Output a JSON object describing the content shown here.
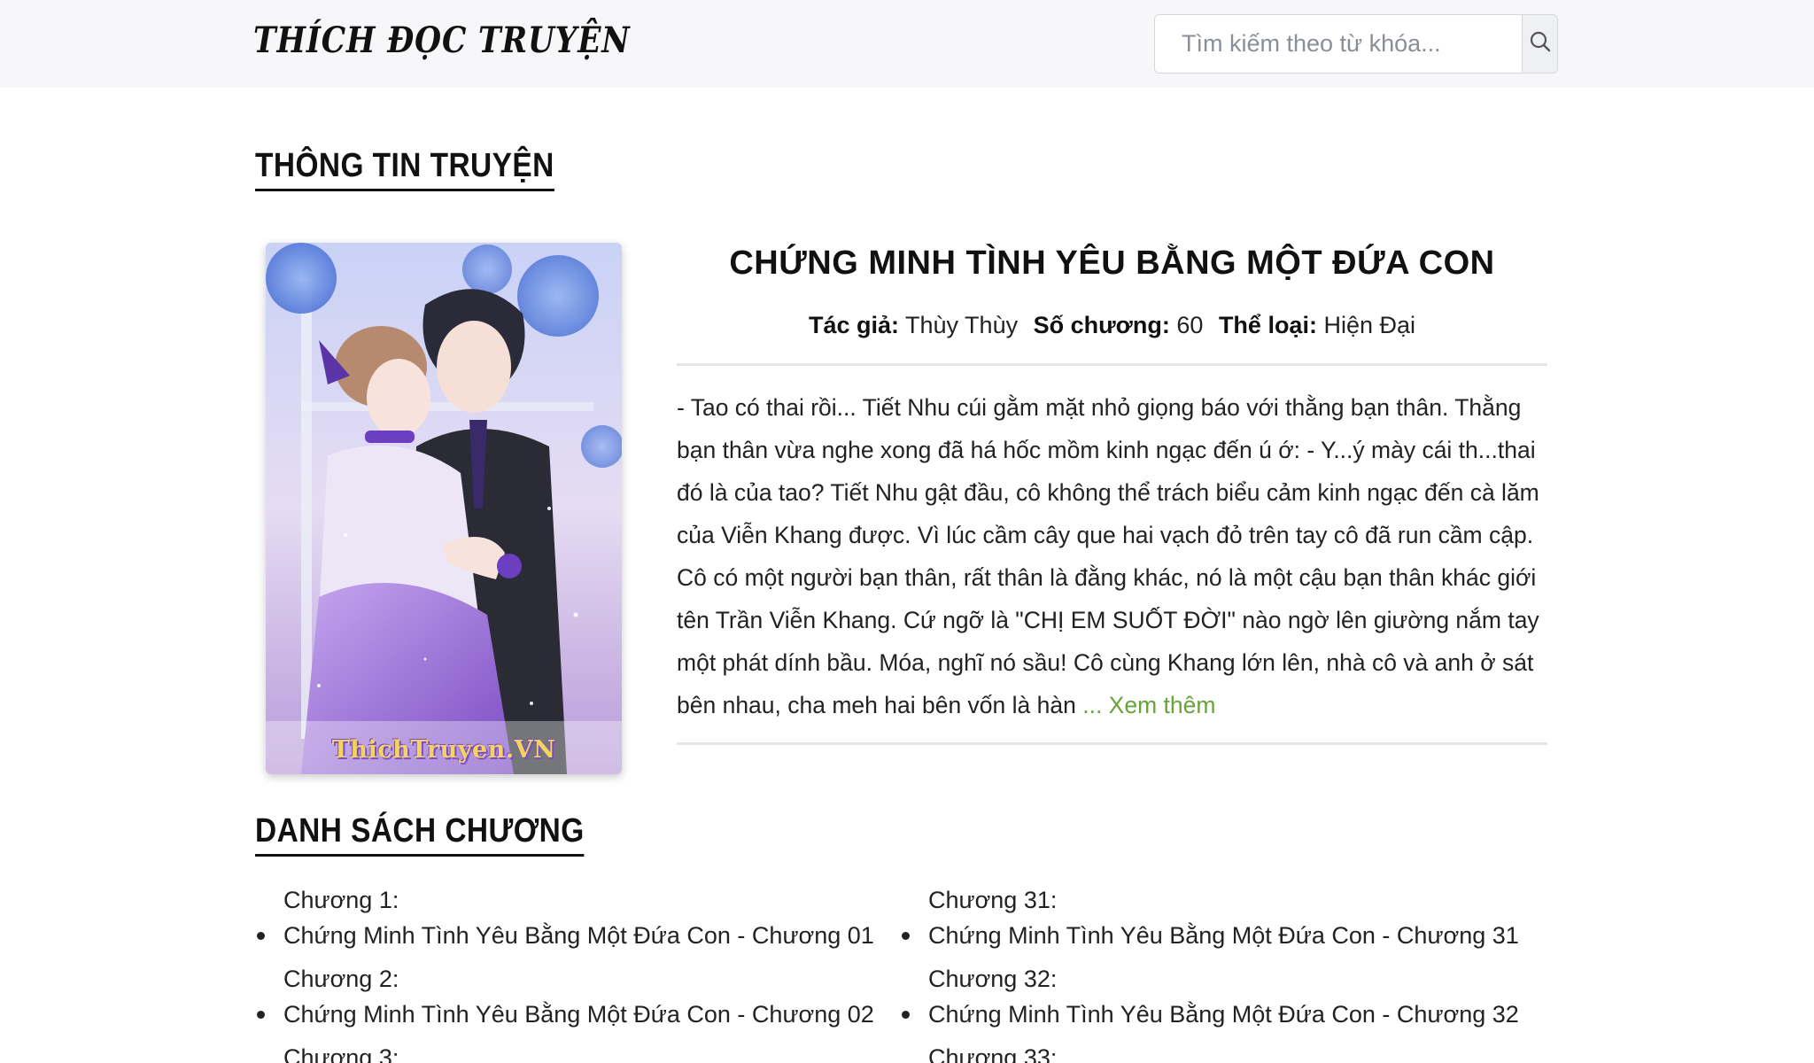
{
  "header": {
    "logo_text": "THÍCH ĐỌC TRUYỆN",
    "search_placeholder": "Tìm kiếm theo từ khóa...",
    "search_icon": "search-icon"
  },
  "info_section": {
    "heading": "THÔNG TIN TRUYỆN"
  },
  "cover": {
    "watermark": "ThichTruyen.VN"
  },
  "story": {
    "title": "CHỨNG MINH TÌNH YÊU BẰNG MỘT ĐỨA CON",
    "author_label": "Tác giả:",
    "author": "Thùy Thùy",
    "chapters_label": "Số chương:",
    "chapters_count": "60",
    "genre_label": "Thể loại:",
    "genre": "Hiện Đại",
    "description": "- Tao có thai rồi... Tiết Nhu cúi gằm mặt nhỏ giọng báo với thằng bạn thân. Thằng bạn thân vừa nghe xong đã há hốc mồm kinh ngạc đến ú ớ: - Y...ý mày cái th...thai đó là của tao? Tiết Nhu gật đầu, cô không thể trách biểu cảm kinh ngạc đến cà lăm của Viễn Khang được. Vì lúc cầm cây que hai vạch đỏ trên tay cô đã run cầm cập. Cô có một người bạn thân, rất thân là đằng khác, nó là một cậu bạn thân khác giới tên Trần Viễn Khang. Cứ ngỡ là \"CHỊ EM SUỐT ĐỜI\" nào ngờ lên giường nắm tay một phát dính bầu. Móa, nghĩ nó sầu! Cô cùng Khang lớn lên, nhà cô và anh ở sát bên nhau, cha meh hai bên vốn là hàn",
    "read_more": "... Xem thêm"
  },
  "chapter_section": {
    "heading": "DANH SÁCH CHƯƠNG"
  },
  "chapter_columns": [
    [
      {
        "label": "Chương 1:",
        "title": "Chứng Minh Tình Yêu Bằng Một Đứa Con - Chương 01"
      },
      {
        "label": "Chương 2:",
        "title": "Chứng Minh Tình Yêu Bằng Một Đứa Con - Chương 02"
      },
      {
        "label": "Chương 3:",
        "title": ""
      }
    ],
    [
      {
        "label": "Chương 31:",
        "title": "Chứng Minh Tình Yêu Bằng Một Đứa Con - Chương 31"
      },
      {
        "label": "Chương 32:",
        "title": "Chứng Minh Tình Yêu Bằng Một Đứa Con - Chương 32"
      },
      {
        "label": "Chương 33:",
        "title": ""
      }
    ]
  ],
  "colors": {
    "header_bg": "#f7f7f9",
    "read_more": "#6aa23c",
    "text": "#222222"
  }
}
